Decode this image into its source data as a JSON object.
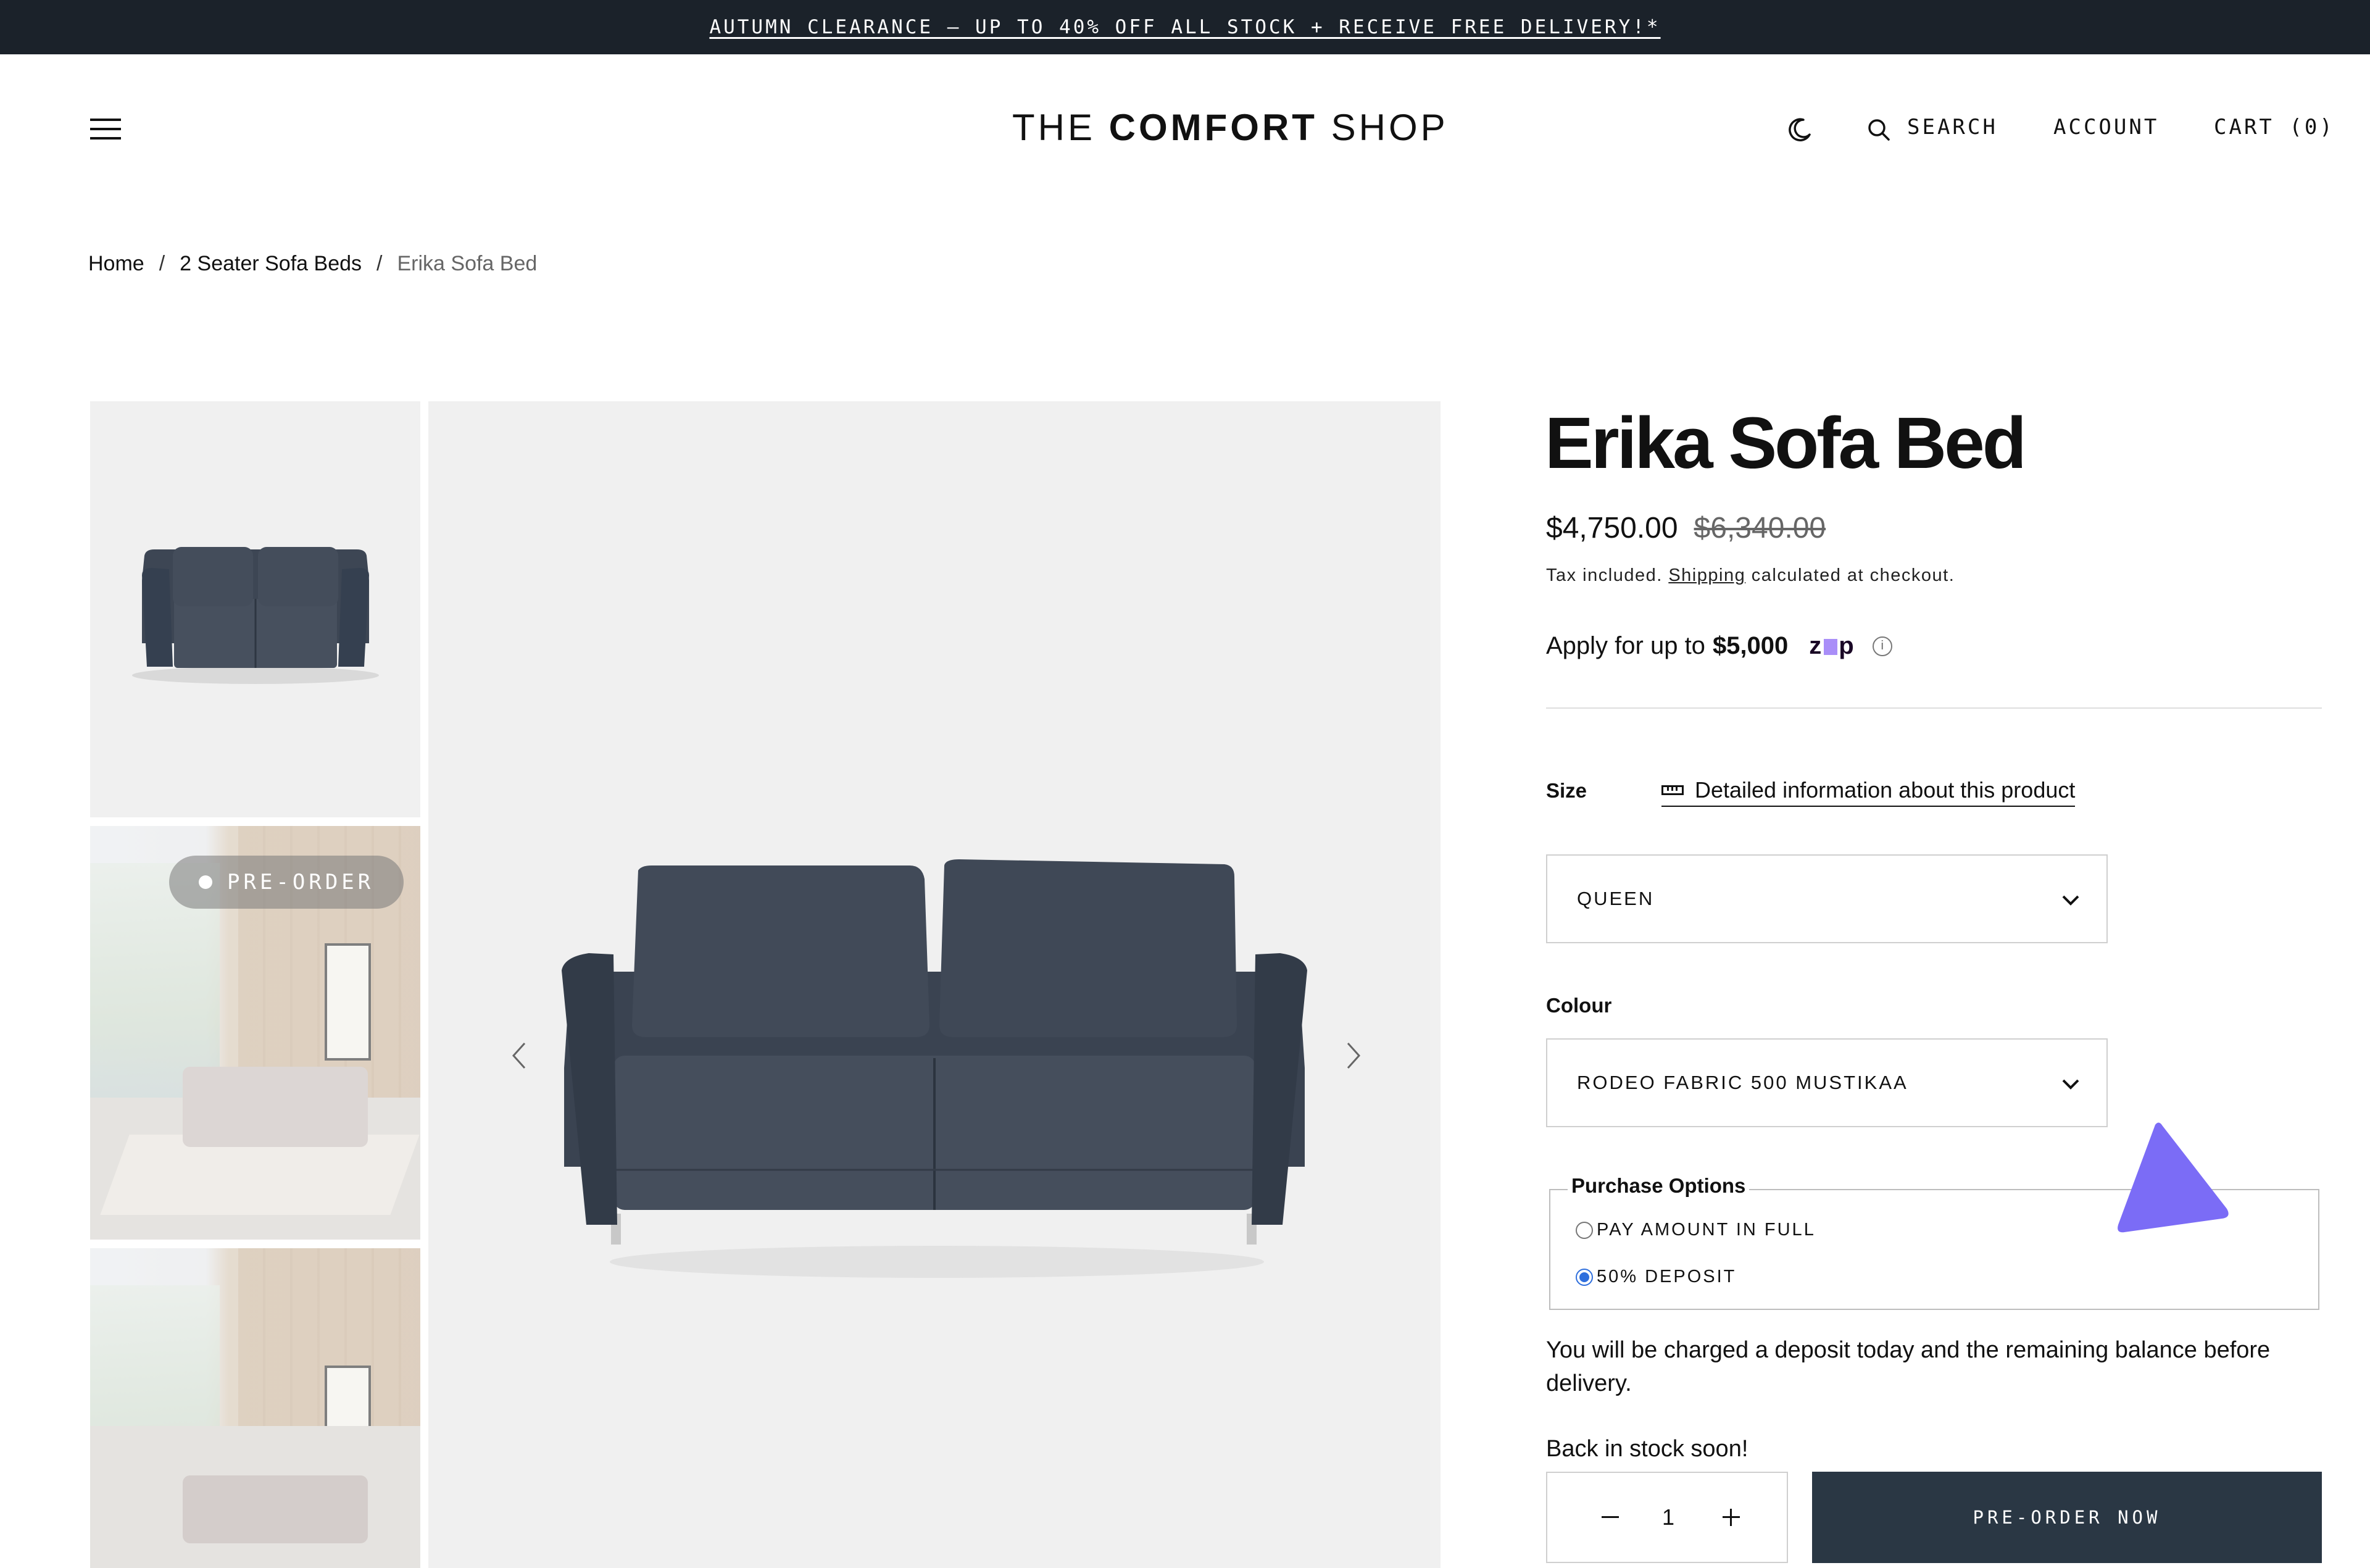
{
  "announcement": {
    "text": "AUTUMN CLEARANCE – UP TO 40% OFF ALL STOCK + RECEIVE FREE DELIVERY!*"
  },
  "header": {
    "logo": {
      "part1": "THE ",
      "part2": "COMFORT",
      "part3": " SHOP"
    },
    "search_label": "SEARCH",
    "account_label": "ACCOUNT",
    "cart_label": "CART (0)"
  },
  "breadcrumb": {
    "home": "Home",
    "separator": "/",
    "category": "2 Seater Sofa Beds",
    "current": "Erika Sofa Bed"
  },
  "gallery": {
    "badge": "PRE-ORDER",
    "sofa_color": "#3d4654"
  },
  "product": {
    "title": "Erika Sofa Bed",
    "price": "$4,750.00",
    "compare_price": "$6,340.00",
    "tax_prefix": "Tax included. ",
    "tax_link": "Shipping",
    "tax_suffix": " calculated at checkout.",
    "zip_prefix": "Apply for up to ",
    "zip_amount": "$5,000",
    "zip_brand_start": "z",
    "zip_brand_end": "p"
  },
  "options": {
    "size_label": "Size",
    "detail_link": "Detailed information about this product",
    "size_value": "QUEEN",
    "colour_label": "Colour",
    "colour_value": "RODEO FABRIC 500 MUSTIKAA"
  },
  "purchase_options": {
    "legend": "Purchase Options",
    "choices": [
      {
        "label": "PAY AMOUNT IN FULL",
        "selected": false
      },
      {
        "label": "50% DEPOSIT",
        "selected": true
      }
    ],
    "note": "You will be charged a deposit today and the remaining balance before delivery."
  },
  "stock_message": "Back in stock soon!",
  "quantity": {
    "value": "1"
  },
  "cta": {
    "label": "PRE-ORDER NOW",
    "color": "#2a3744"
  },
  "colors": {
    "accent_cursor": "#7b6cf6",
    "radio_selected": "#2f6fdd"
  }
}
